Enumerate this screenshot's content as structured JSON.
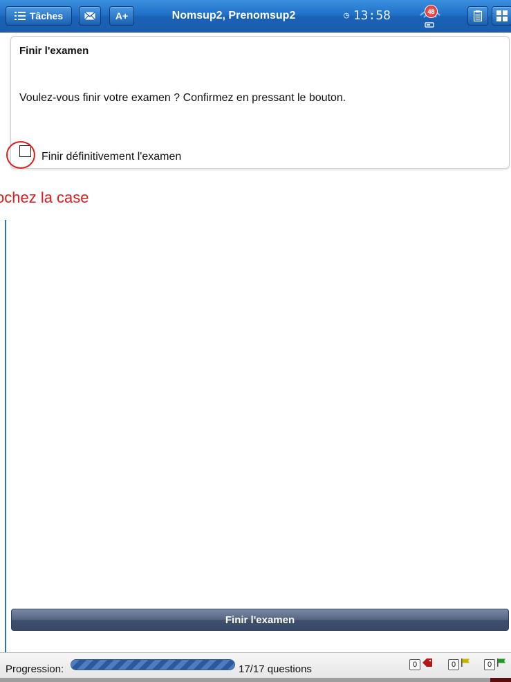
{
  "topbar": {
    "tasks_label": "Tâches",
    "font_label": "A+",
    "user_name": "Nomsup2, Prenomsup2",
    "clock_icon": "clock-icon",
    "time": "13:58",
    "notification_count": "48"
  },
  "card": {
    "title": "Finir l'examen",
    "message": "Voulez-vous finir votre examen ? Confirmez en pressant le bouton.",
    "checkbox_label": "Finir définitivement l'examen",
    "checked": false
  },
  "annotation": {
    "text": "ochez la case",
    "color": "#e01a1a"
  },
  "finish_button": {
    "label": "Finir l'examen"
  },
  "footer": {
    "progress_label": "Progression:",
    "progress_fraction": 1.0,
    "progress_count": "17/17 questions",
    "counters": [
      {
        "value": "0",
        "icon": "tag-icon",
        "color": "#b01818"
      },
      {
        "value": "0",
        "icon": "flag-icon",
        "color": "#c8b400"
      },
      {
        "value": "0",
        "icon": "flag-icon",
        "color": "#1c9a1c"
      }
    ]
  },
  "colors": {
    "brand_blue": "#1f6fc6",
    "button_slate": "#536481"
  }
}
